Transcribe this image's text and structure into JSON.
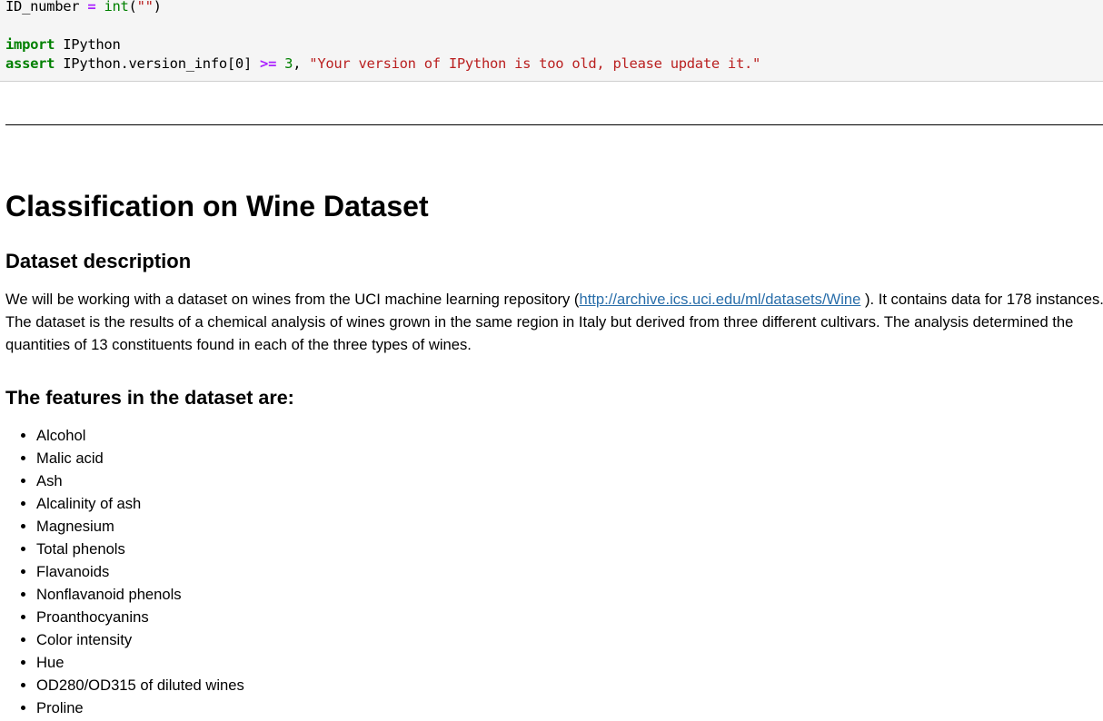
{
  "code_cell": {
    "line1": {
      "var": "ID_number",
      "op": "=",
      "func": "int",
      "open": "(",
      "arg": "\"\"",
      "close": ")"
    },
    "line3": {
      "kw": "import",
      "module": "IPython"
    },
    "line4": {
      "kw": "assert",
      "expr": "IPython.version_info[0]",
      "op": ">=",
      "num": "3",
      "comma": ",",
      "msg": "\"Your version of IPython is too old, please update it.\""
    }
  },
  "markdown": {
    "title": "Classification on Wine Dataset",
    "section_heading": "Dataset description",
    "description": {
      "before_link": "We will be working with a dataset on wines from the UCI machine learning repository (",
      "link_text": "http://archive.ics.uci.edu/ml/datasets/Wine",
      "after_link": " ). It contains data for 178 instances. The dataset is the results of a chemical analysis of wines grown in the same region in Italy but derived from three different cultivars. The analysis determined the quantities of 13 constituents found in each of the three types of wines."
    },
    "features_heading": "The features in the dataset are:",
    "features": [
      "Alcohol",
      "Malic acid",
      "Ash",
      "Alcalinity of ash",
      "Magnesium",
      "Total phenols",
      "Flavanoids",
      "Nonflavanoid phenols",
      "Proanthocyanins",
      "Color intensity",
      "Hue",
      "OD280/OD315 of diluted wines",
      "Proline"
    ]
  },
  "colors": {
    "keyword": "#008000",
    "operator": "#aa22ff",
    "string": "#ba2121",
    "link": "#296eaa",
    "code_bg": "#f5f5f5"
  }
}
